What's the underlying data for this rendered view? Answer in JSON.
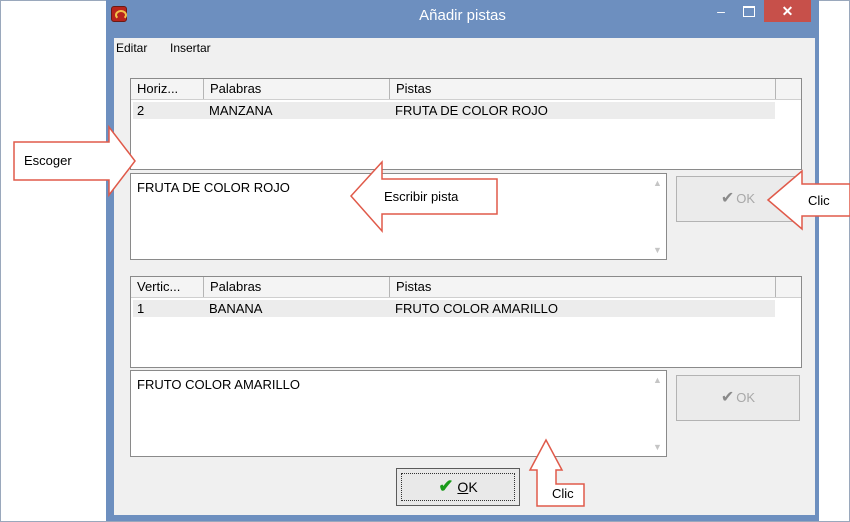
{
  "window": {
    "title": "Añadir pistas",
    "minimize": "–",
    "close": "✕"
  },
  "menu": [
    "Editar",
    "Insertar"
  ],
  "horizontal": {
    "columns": [
      "Horiz...",
      "Palabras",
      "Pistas"
    ],
    "rows": [
      [
        "2",
        "MANZANA",
        "FRUTA DE COLOR ROJO"
      ]
    ],
    "clue_text": "FRUTA DE COLOR ROJO",
    "ok_label": "OK"
  },
  "vertical": {
    "columns": [
      "Vertic...",
      "Palabras",
      "Pistas"
    ],
    "rows": [
      [
        "1",
        "BANANA",
        "FRUTO COLOR AMARILLO"
      ]
    ],
    "clue_text": "FRUTO COLOR AMARILLO",
    "ok_label": "OK"
  },
  "main_ok": {
    "mnemonic": "O",
    "rest": "K"
  },
  "callouts": {
    "escoger": "Escoger",
    "escribir": "Escribir pista",
    "clic_side": "Clic",
    "clic_bottom": "Clic"
  },
  "colors": {
    "titlebar": "#6d8fbf",
    "close_button": "#c7504a",
    "callout_border": "#e05a4a",
    "check_green": "#1a9a1a"
  }
}
